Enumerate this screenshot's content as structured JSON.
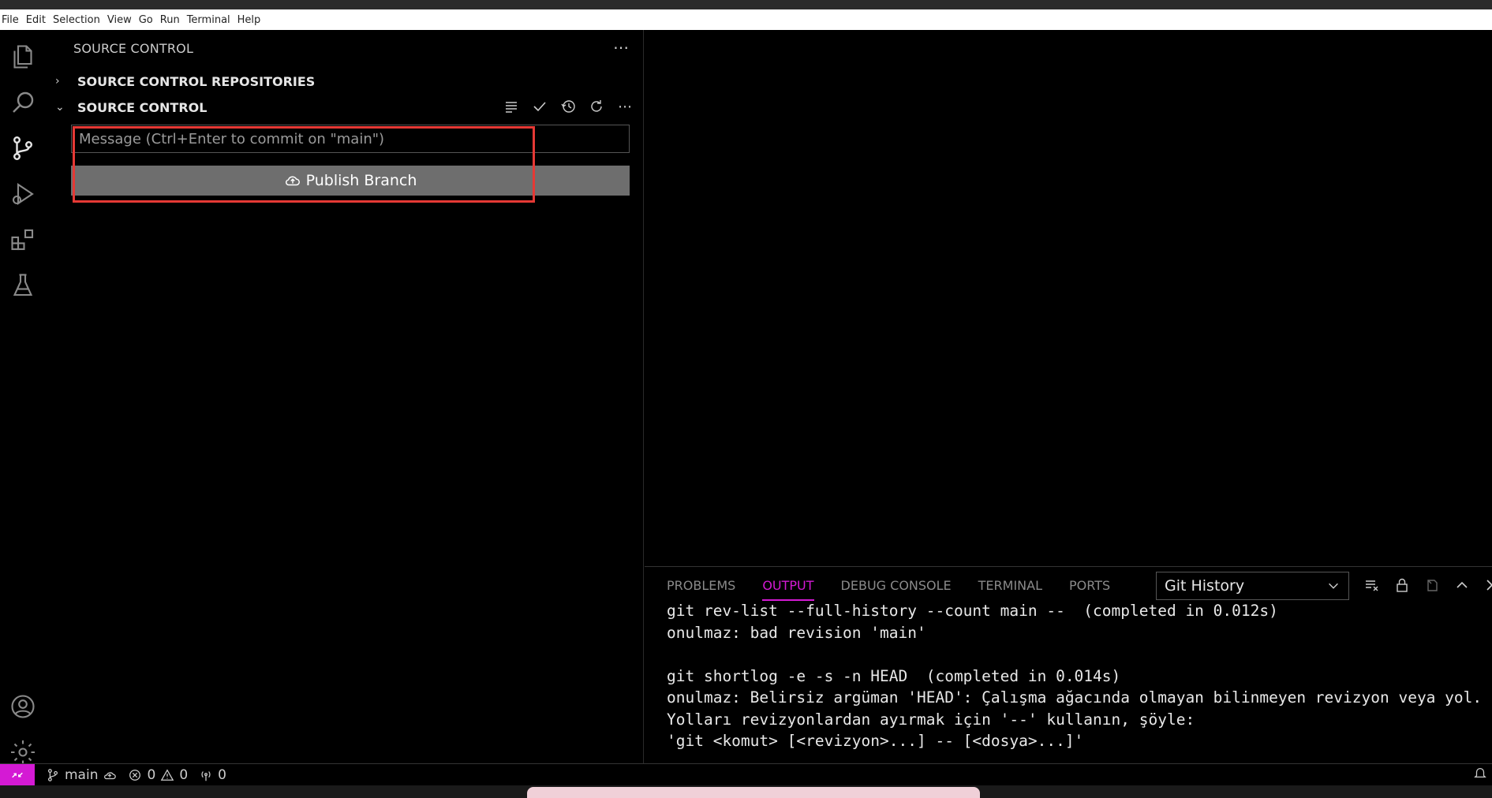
{
  "menu": [
    "File",
    "Edit",
    "Selection",
    "View",
    "Go",
    "Run",
    "Terminal",
    "Help"
  ],
  "sidebar": {
    "title": "SOURCE CONTROL",
    "sections": {
      "repositories": "SOURCE CONTROL REPOSITORIES",
      "source_control": "SOURCE CONTROL"
    },
    "message_placeholder": "Message (Ctrl+Enter to commit on \"main\")",
    "publish_label": "Publish Branch"
  },
  "panel": {
    "tabs": [
      "PROBLEMS",
      "OUTPUT",
      "DEBUG CONSOLE",
      "TERMINAL",
      "PORTS"
    ],
    "active_tab": "OUTPUT",
    "output_channel": "Git History",
    "output_text": "git rev-list --full-history --count main --  (completed in 0.012s)\nonulmaz: bad revision 'main'\n\ngit shortlog -e -s -n HEAD  (completed in 0.014s)\nonulmaz: Belirsiz argüman 'HEAD': Çalışma ağacında olmayan bilinmeyen revizyon veya yol.\nYolları revizyonlardan ayırmak için '--' kullanın, şöyle:\n'git <komut> [<revizyon>...] -- [<dosya>...]'"
  },
  "status": {
    "branch": "main",
    "errors": "0",
    "warnings": "0",
    "ports": "0"
  },
  "colors": {
    "accent": "#d41ad4",
    "highlight": "#e53935",
    "button": "#6e6e6e"
  }
}
